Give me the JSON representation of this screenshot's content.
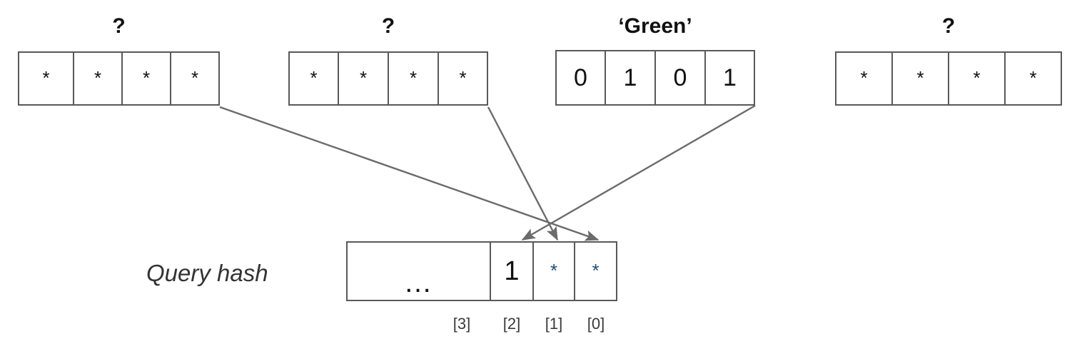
{
  "diagram": {
    "title_hidden": "",
    "colors": {
      "box_border": "#595959",
      "line": "#6b6b6b",
      "blue_star": "#1f4e79",
      "text": "#111111",
      "background": "#ffffff"
    },
    "registers": [
      {
        "id": "register-1",
        "title": "?",
        "cells": [
          "*",
          "*",
          "*",
          "*"
        ]
      },
      {
        "id": "register-2",
        "title": "?",
        "cells": [
          "*",
          "*",
          "*",
          "*"
        ]
      },
      {
        "id": "register-green",
        "title": "‘Green’",
        "cells": [
          "0",
          "1",
          "0",
          "1"
        ]
      },
      {
        "id": "register-4",
        "title": "?",
        "cells": [
          "*",
          "*",
          "*",
          "*"
        ]
      }
    ],
    "query_hash": {
      "label": "Query hash",
      "cells": [
        {
          "value": "…",
          "style": "ellipsis"
        },
        {
          "value": "1",
          "style": "digit"
        },
        {
          "value": "*",
          "style": "blue-star"
        },
        {
          "value": "*",
          "style": "blue-star"
        }
      ],
      "index_labels": [
        "[3]",
        "[2]",
        "[1]",
        "[0]"
      ]
    },
    "arrows": [
      {
        "name": "arrow-register1-to-bit0",
        "from": "register-1",
        "to": "queryhash-bit-0"
      },
      {
        "name": "arrow-register2-to-bit1",
        "from": "register-2",
        "to": "queryhash-bit-1"
      },
      {
        "name": "arrow-green-to-bit2",
        "from": "register-green",
        "to": "queryhash-bit-2"
      }
    ]
  }
}
